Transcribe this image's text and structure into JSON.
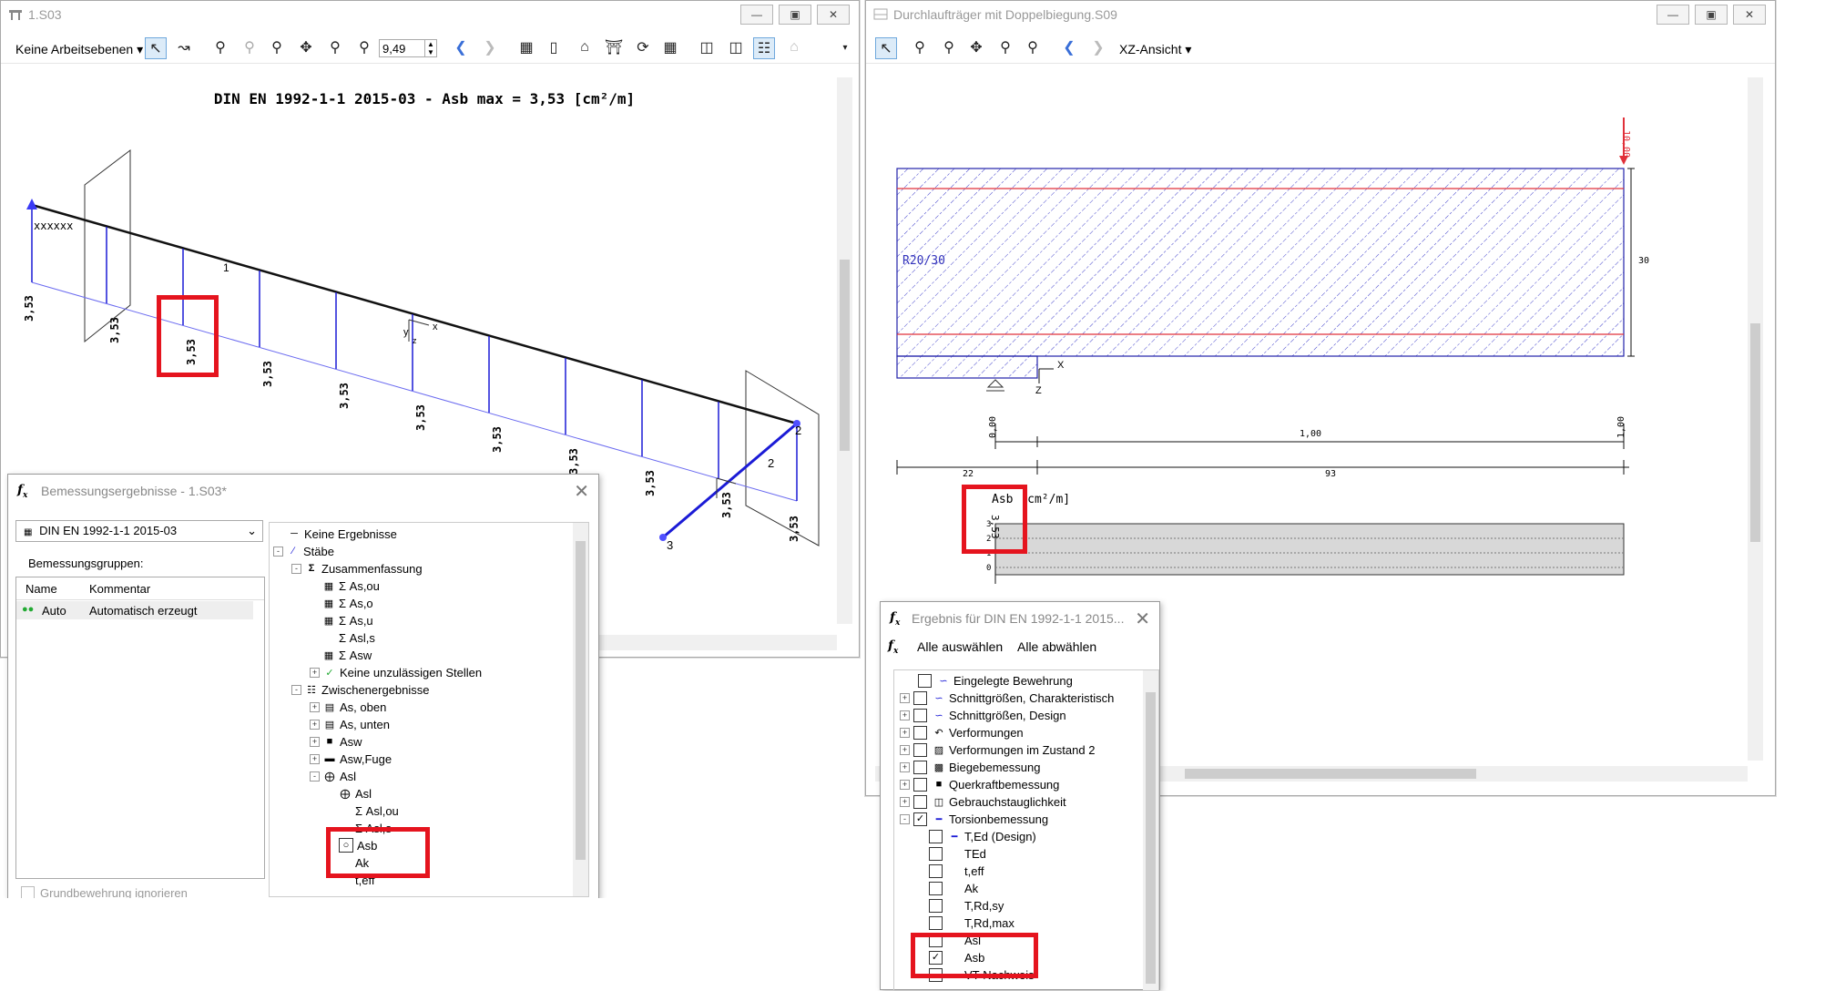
{
  "left_window": {
    "title": "1.S03",
    "toolbar": {
      "workplane_label": "Keine Arbeitsebenen",
      "zoom_value": "9,49"
    },
    "diagram": {
      "heading": "DIN EN 1992-1-1 2015-03 - Asb max = 3,53 [cm²/m]",
      "value_label": "3,53",
      "node_label": "xxxxxx",
      "member_1_label": "1",
      "member_2_label": "2",
      "node_2_label": "2",
      "node_3_label": "3",
      "axis_x": "x",
      "axis_y": "y",
      "axis_z": "z"
    }
  },
  "right_window": {
    "title": "Durchlaufträger mit Doppelbiegung.S09",
    "toolbar": {
      "view_label": "XZ-Ansicht"
    },
    "section": {
      "profile_label": "R20/30",
      "load_label": "10,00",
      "height_dim": "30",
      "axis_x": "X",
      "axis_z": "Z",
      "dim_left": "0,00",
      "dim_mid": "1,00",
      "dim_right": "1,00",
      "dim_22": "22",
      "dim_93": "93",
      "result_label": "Asb [cm²/m]",
      "result_value": "3,53",
      "y_ticks": [
        "3",
        "2",
        "1",
        "0"
      ]
    }
  },
  "bemessung_panel": {
    "title": "Bemessungsergebnisse - 1.S03*",
    "standard": "DIN EN 1992-1-1 2015-03",
    "groups_label": "Bemessungsgruppen:",
    "columns": [
      "Name",
      "Kommentar"
    ],
    "rows": [
      {
        "name": "Auto",
        "comment": "Automatisch erzeugt"
      }
    ],
    "ignore_label": "Grundbewehrung ignorieren",
    "tree": [
      {
        "label": "Keine Ergebnisse"
      },
      {
        "label": "Stäbe"
      },
      {
        "label": "Zusammenfassung"
      },
      {
        "label": "Σ As,ou"
      },
      {
        "label": "Σ As,o"
      },
      {
        "label": "Σ As,u"
      },
      {
        "label": "Σ Asl,s"
      },
      {
        "label": "Σ Asw"
      },
      {
        "label": "Keine unzulässigen Stellen"
      },
      {
        "label": "Zwischenergebnisse"
      },
      {
        "label": "As, oben"
      },
      {
        "label": "As, unten"
      },
      {
        "label": "Asw"
      },
      {
        "label": "Asw,Fuge"
      },
      {
        "label": "Asl"
      },
      {
        "label": "Asl"
      },
      {
        "label": "Σ Asl,ou"
      },
      {
        "label": "Σ Asl,s"
      },
      {
        "label": "Asb"
      },
      {
        "label": "Ak"
      },
      {
        "label": "t,eff"
      }
    ]
  },
  "ergebnis_panel": {
    "title": "Ergebnis für DIN EN 1992-1-1 2015...",
    "select_all": "Alle auswählen",
    "deselect_all": "Alle abwählen",
    "items": [
      {
        "label": "Eingelegte Bewehrung",
        "checked": false
      },
      {
        "label": "Schnittgrößen, Charakteristisch",
        "checked": false
      },
      {
        "label": "Schnittgrößen, Design",
        "checked": false
      },
      {
        "label": "Verformungen",
        "checked": false
      },
      {
        "label": "Verformungen im Zustand 2",
        "checked": false
      },
      {
        "label": "Biegebemessung",
        "checked": false
      },
      {
        "label": "Querkraftbemessung",
        "checked": false
      },
      {
        "label": "Gebrauchstauglichkeit",
        "checked": false
      },
      {
        "label": "Torsionbemessung",
        "checked": true
      },
      {
        "label": "T,Ed (Design)",
        "checked": false
      },
      {
        "label": "TEd",
        "checked": false
      },
      {
        "label": "t,eff",
        "checked": false
      },
      {
        "label": "Ak",
        "checked": false
      },
      {
        "label": "T,Rd,sy",
        "checked": false
      },
      {
        "label": "T,Rd,max",
        "checked": false
      },
      {
        "label": "Asl",
        "checked": false
      },
      {
        "label": "Asb",
        "checked": true
      },
      {
        "label": "VT-Nachweis",
        "checked": false
      }
    ]
  },
  "colors": {
    "highlight_red": "#e5141e",
    "member_blue": "#1b1bd6",
    "section_red": "#e0303a"
  }
}
